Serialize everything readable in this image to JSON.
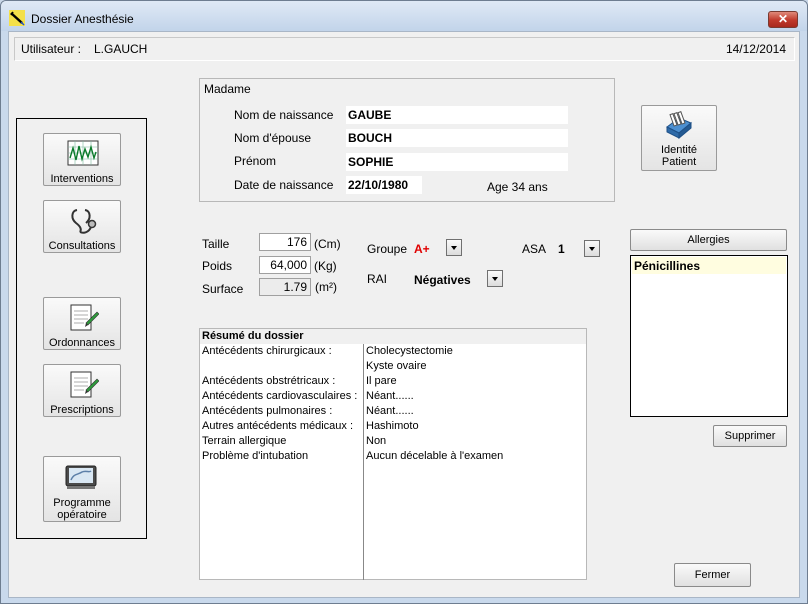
{
  "window": {
    "title": "Dossier Anesthésie",
    "close_glyph": "✕"
  },
  "user_bar": {
    "label": "Utilisateur :",
    "name": "L.GAUCH",
    "date": "14/12/2014"
  },
  "tools": [
    {
      "label": "Interventions",
      "icon": "chart-icon"
    },
    {
      "label": "Consultations",
      "icon": "stethoscope-icon"
    },
    {
      "label": "Ordonnances",
      "icon": "prescription-pad-icon"
    },
    {
      "label": "Prescriptions",
      "icon": "prescription-pad-icon"
    },
    {
      "label_line1": "Programme",
      "label_line2": "opératoire",
      "icon": "surgery-schedule-icon"
    }
  ],
  "patient": {
    "civility": "Madame",
    "birth_name_label": "Nom de naissance",
    "birth_name": "GAUBE",
    "married_name_label": "Nom d'épouse",
    "married_name": "BOUCH",
    "first_name_label": "Prénom",
    "first_name": "SOPHIE",
    "birth_date_label": "Date de naissance",
    "birth_date": "22/10/1980",
    "age": "Age 34 ans"
  },
  "identity_button": {
    "line1": "Identité",
    "line2": "Patient",
    "icon": "patient-files-icon"
  },
  "measures": {
    "height_label": "Taille",
    "height": "176",
    "height_unit": "(Cm)",
    "weight_label": "Poids",
    "weight": "64,000",
    "weight_unit": "(Kg)",
    "surface_label": "Surface",
    "surface": "1.79",
    "surface_unit": "(m²)"
  },
  "blood": {
    "group_label": "Groupe",
    "group_value": "A+",
    "rai_label": "RAI",
    "rai_value": "Négatives",
    "asa_label": "ASA",
    "asa_value": "1",
    "group_color": "#e00000"
  },
  "summary": {
    "title": "Résumé du dossier",
    "rows": [
      {
        "key": "Antécédents chirurgicaux :",
        "value": "Cholecystectomie"
      },
      {
        "key": "",
        "value": "Kyste ovaire"
      },
      {
        "key": "Antécédents obstrétricaux   :",
        "value": "Il pare"
      },
      {
        "key": "Antécédents cardiovasculaires :",
        "value": "Néant......"
      },
      {
        "key": "Antécédents pulmonaires :",
        "value": "Néant......"
      },
      {
        "key": "Autres antécédents médicaux  :",
        "value": "Hashimoto"
      },
      {
        "key": "Terrain allergique",
        "value": "Non"
      },
      {
        "key": "Problème d'intubation",
        "value": "Aucun décelable à l'examen"
      }
    ]
  },
  "allergies": {
    "button_label": "Allergies",
    "items": [
      "Pénicillines"
    ],
    "delete_label": "Supprimer"
  },
  "close_label": "Fermer"
}
